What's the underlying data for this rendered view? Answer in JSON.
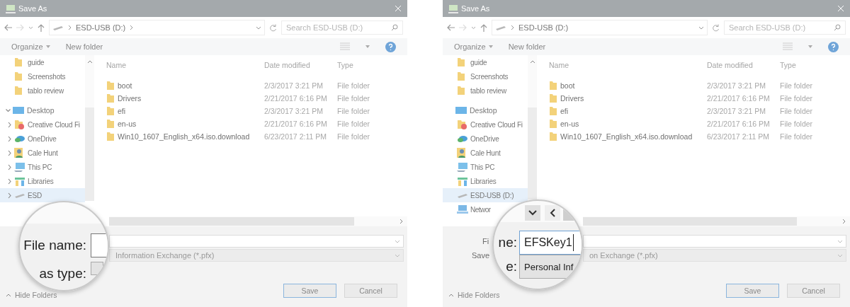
{
  "dialogs": [
    {
      "title": "Save As",
      "address": {
        "path": "ESD-USB (D:)",
        "trailing_chevron": true
      },
      "search": {
        "placeholder": "Search ESD-USB (D:)"
      },
      "toolbar": {
        "organize": "Organize",
        "new_folder": "New folder"
      },
      "nav": {
        "expanders_visible": true,
        "pinned": [
          {
            "label": "guide",
            "kind": "folder",
            "selected": false
          },
          {
            "label": "Screenshots",
            "kind": "folder",
            "selected": false
          },
          {
            "label": "tablo review",
            "kind": "folder",
            "selected": false
          }
        ],
        "tree": [
          {
            "label": "Desktop",
            "kind": "desktop",
            "selected": false,
            "expanded": true,
            "children": [
              {
                "label": "Creative Cloud Fi",
                "kind": "creative-cloud",
                "selected": false,
                "expanded": false
              },
              {
                "label": "OneDrive",
                "kind": "cloud",
                "selected": false,
                "expanded": false
              },
              {
                "label": "Cale Hunt",
                "kind": "user",
                "selected": false,
                "expanded": false
              },
              {
                "label": "This PC",
                "kind": "pc",
                "selected": false,
                "expanded": false
              },
              {
                "label": "Libraries",
                "kind": "libraries",
                "selected": false,
                "expanded": false
              },
              {
                "label": "ESD",
                "kind": "drive",
                "selected": true,
                "expanded": false
              }
            ]
          }
        ]
      },
      "columns": [
        "Name",
        "Date modified",
        "Type"
      ],
      "files": [
        {
          "name": "boot",
          "date": "2/3/2017 3:21 PM",
          "type": "File folder"
        },
        {
          "name": "Drivers",
          "date": "2/21/2017 6:16 PM",
          "type": "File folder"
        },
        {
          "name": "efi",
          "date": "2/3/2017 3:21 PM",
          "type": "File folder"
        },
        {
          "name": "en-us",
          "date": "2/21/2017 6:16 PM",
          "type": "File folder"
        },
        {
          "name": "Win10_1607_English_x64.iso.download",
          "date": "6/23/2017 2:11 PM",
          "type": "File folder"
        }
      ],
      "save_type": {
        "value": "Information Exchange (*.pfx)"
      },
      "buttons": [
        {
          "label": "Save",
          "default": true
        },
        {
          "label": "Cancel",
          "default": false
        }
      ],
      "hide_folders": "Hide Folders",
      "magnifier": {
        "scroll_buttons": false,
        "file_label": "File name:",
        "type_label": "as type:"
      }
    },
    {
      "title": "Save As",
      "address": {
        "path": "ESD-USB (D:)",
        "trailing_chevron": false
      },
      "search": {
        "placeholder": "Search ESD-USB (D:)"
      },
      "toolbar": {
        "organize": "Organize",
        "new_folder": "New folder"
      },
      "nav": {
        "expanders_visible": false,
        "pinned": [
          {
            "label": "guide",
            "kind": "folder",
            "selected": false
          },
          {
            "label": "Screenshots",
            "kind": "folder",
            "selected": false
          },
          {
            "label": "tablo review",
            "kind": "folder",
            "selected": false
          }
        ],
        "tree": [
          {
            "label": "Desktop",
            "kind": "desktop",
            "selected": false,
            "children": [
              {
                "label": "Creative Cloud Fi",
                "kind": "creative-cloud",
                "selected": false
              },
              {
                "label": "OneDrive",
                "kind": "cloud",
                "selected": false
              },
              {
                "label": "Cale Hunt",
                "kind": "user",
                "selected": false
              },
              {
                "label": "This PC",
                "kind": "pc",
                "selected": false
              },
              {
                "label": "Libraries",
                "kind": "libraries",
                "selected": false
              },
              {
                "label": "ESD-USB (D:)",
                "kind": "drive",
                "selected": true
              },
              {
                "label": "Networ",
                "kind": "network",
                "selected": false
              }
            ]
          }
        ]
      },
      "columns": [
        "Name",
        "Date modified",
        "Type"
      ],
      "files": [
        {
          "name": "boot",
          "date": "2/3/2017 3:21 PM",
          "type": "File folder"
        },
        {
          "name": "Drivers",
          "date": "2/21/2017 6:16 PM",
          "type": "File folder"
        },
        {
          "name": "efi",
          "date": "2/3/2017 3:21 PM",
          "type": "File folder"
        },
        {
          "name": "en-us",
          "date": "2/21/2017 6:16 PM",
          "type": "File folder"
        },
        {
          "name": "Win10_1607_English_x64.iso.download",
          "date": "6/23/2017 2:11 PM",
          "type": "File folder"
        }
      ],
      "file_name": {
        "label": "Fi"
      },
      "save_type": {
        "label": "Save",
        "value": "on Exchange (*.pfx)"
      },
      "buttons": [
        {
          "label": "Save",
          "default": true
        },
        {
          "label": "Cancel",
          "default": false
        }
      ],
      "hide_folders": "Hide Folders",
      "magnifier": {
        "scroll_buttons": true,
        "file_label": "ne:",
        "file_value": "EFSKey1",
        "caret": true,
        "type_label": "e:",
        "type_value": "Personal Inf"
      }
    }
  ]
}
